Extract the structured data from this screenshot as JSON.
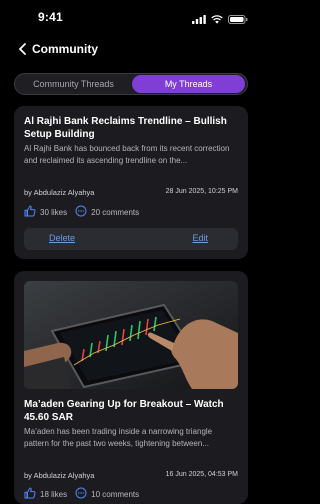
{
  "status": {
    "time": "9:41"
  },
  "header": {
    "title": "Community"
  },
  "tabs": [
    {
      "label": "Community Threads",
      "active": false
    },
    {
      "label": "My Threads",
      "active": true
    }
  ],
  "posts": [
    {
      "title": "Al Rajhi Bank Reclaims Trendline – Bullish Setup Building",
      "body": "Al Rajhi Bank has bounced back from its recent correction and reclaimed its ascending trendline on the...",
      "author": "by Abdulaziz Alyahya",
      "date": "28 Jun 2025, 10:25 PM",
      "likes": "30 likes",
      "comments": "20 comments",
      "delete_label": "Delete",
      "edit_label": "Edit"
    },
    {
      "title": "Ma’aden Gearing Up for Breakout – Watch 45.60 SAR",
      "body": "Ma’aden has been trading inside a narrowing triangle pattern for the past two weeks, tightening between...",
      "author": "by Abdulaziz Alyahya",
      "date": "16 Jun 2025, 04:53 PM",
      "likes": "18 likes",
      "comments": "10 comments"
    }
  ],
  "colors": {
    "accent": "#7f3fd6",
    "link": "#6f9ae6",
    "card": "#1c1c20",
    "background": "#000000"
  },
  "icons": [
    "wifi-icon",
    "signal-icon",
    "battery-icon",
    "back-chevron-icon",
    "thumbs-up-icon",
    "comment-icon"
  ]
}
